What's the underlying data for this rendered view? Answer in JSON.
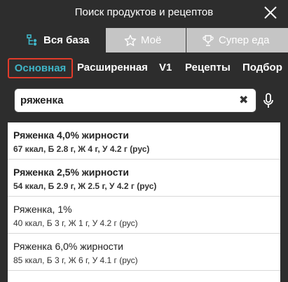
{
  "window": {
    "title": "Поиск продуктов и рецептов"
  },
  "tabs": [
    {
      "label": "Вся база",
      "icon": "hierarchy-icon"
    },
    {
      "label": "Моё",
      "icon": "star-icon"
    },
    {
      "label": "Супер еда",
      "icon": "trophy-icon"
    }
  ],
  "subtabs": [
    "Основная",
    "Расширенная",
    "V1",
    "Рецепты",
    "Подбор"
  ],
  "search": {
    "value": "ряженка"
  },
  "results": [
    {
      "name": "Ряженка 4,0% жирности",
      "desc": "67 ккал, Б 2.8 г, Ж 4 г, У 4.2 г (рус)"
    },
    {
      "name": "Ряженка 2,5% жирности",
      "desc": "54 ккал, Б 2.9 г, Ж 2.5 г, У 4.2 г (рус)"
    },
    {
      "name": "Ряженка, 1%",
      "desc": "40 ккал, Б 3 г, Ж 1 г, У 4.2 г (рус)"
    },
    {
      "name": "Ряженка 6,0% жирности",
      "desc": "85 ккал, Б 3 г, Ж 6 г, У 4.1 г (рус)"
    }
  ],
  "colors": {
    "background": "#2d2d2d",
    "inactive_tab": "#c5c5c5",
    "active_subtab_text": "#3fb5c7",
    "active_subtab_border": "#e23b2a"
  }
}
